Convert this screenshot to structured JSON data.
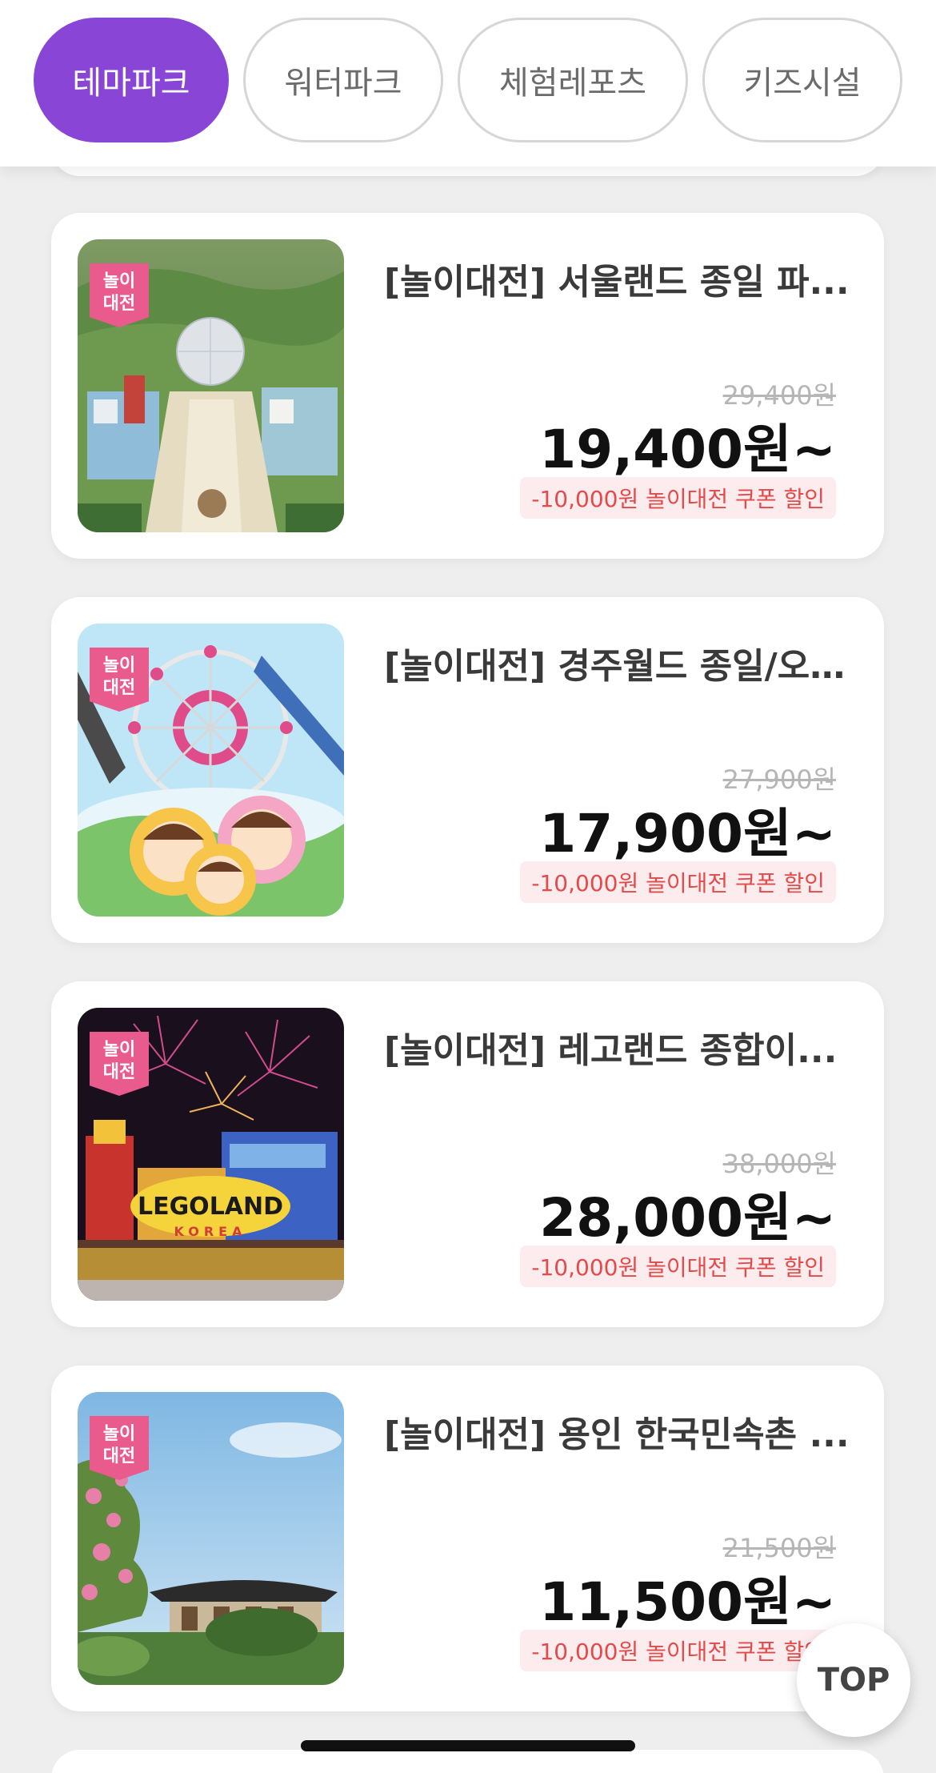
{
  "categories": [
    {
      "label": "테마파크",
      "active": true
    },
    {
      "label": "워터파크",
      "active": false
    },
    {
      "label": "체험레포츠",
      "active": false
    },
    {
      "label": "키즈시설",
      "active": false
    }
  ],
  "badge_text": "놀이\n대전",
  "products": [
    {
      "title": "[놀이대전] 서울랜드 종일 파...",
      "original_price": "29,400원",
      "price": "19,400원~",
      "coupon": "-10,000원 놀이대전 쿠폰 할인"
    },
    {
      "title": "[놀이대전] 경주월드 종일/오...",
      "original_price": "27,900원",
      "price": "17,900원~",
      "coupon": "-10,000원 놀이대전 쿠폰 할인"
    },
    {
      "title": "[놀이대전] 레고랜드 종합이...",
      "original_price": "38,000원",
      "price": "28,000원~",
      "coupon": "-10,000원 놀이대전 쿠폰 할인",
      "image_logo": "LEGOLAND",
      "image_logo_sub": "KOREA"
    },
    {
      "title": "[놀이대전] 용인 한국민속촌 ...",
      "original_price": "21,500원",
      "price": "11,500원~",
      "coupon": "-10,000원 놀이대전 쿠폰 할인"
    }
  ],
  "top_button": "TOP",
  "colors": {
    "accent": "#8845d6",
    "badge": "#e85b8c",
    "coupon_text": "#e34a4a",
    "coupon_bg": "#fdeced"
  }
}
